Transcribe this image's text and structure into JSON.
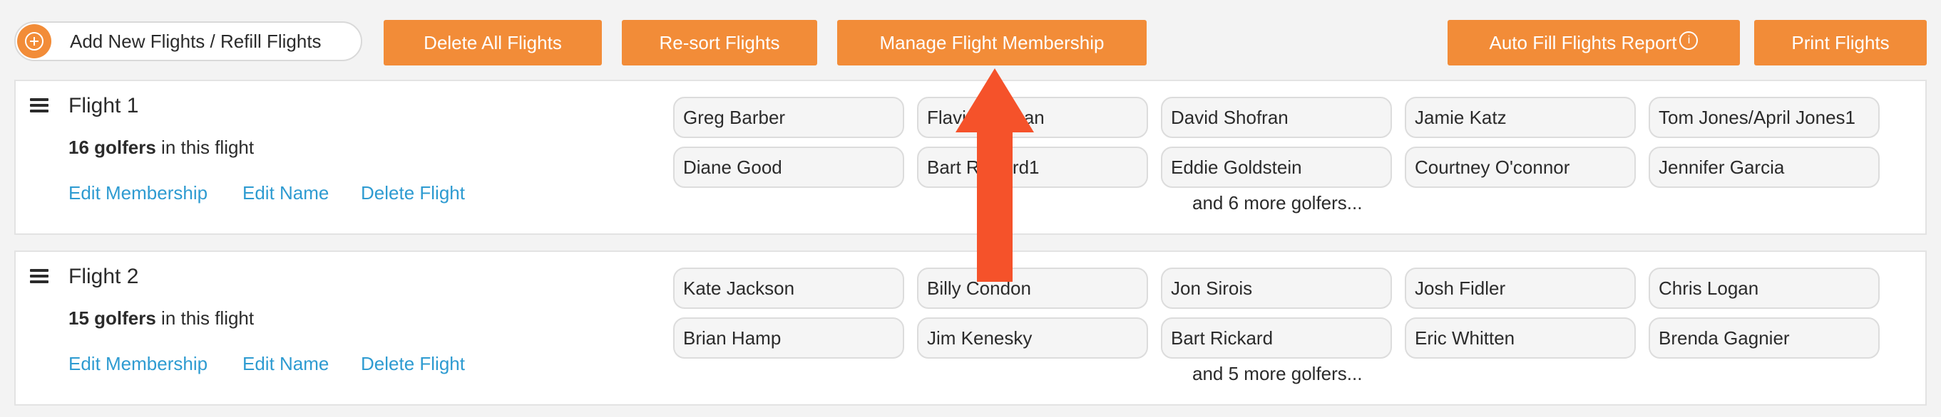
{
  "toolbar": {
    "add_label": "Add New Flights / Refill Flights",
    "delete_all_label": "Delete All Flights",
    "resort_label": "Re-sort Flights",
    "manage_label": "Manage Flight Membership",
    "autofill_label": "Auto Fill Flights Report",
    "print_label": "Print Flights"
  },
  "flights": [
    {
      "title": "Flight 1",
      "count": "16 golfers",
      "count_suffix": " in this flight",
      "links": {
        "edit_membership": "Edit Membership",
        "edit_name": "Edit Name",
        "delete": "Delete Flight"
      },
      "golfers": [
        "Greg Barber",
        "Flavio Hassan",
        "David Shofran",
        "Jamie Katz",
        "Tom Jones/April Jones1",
        "Diane Good",
        "Bart Rickard1",
        "Eddie Goldstein",
        "Courtney O'connor",
        "Jennifer Garcia"
      ],
      "more": "and 6 more golfers..."
    },
    {
      "title": "Flight 2",
      "count": "15 golfers",
      "count_suffix": " in this flight",
      "links": {
        "edit_membership": "Edit Membership",
        "edit_name": "Edit Name",
        "delete": "Delete Flight"
      },
      "golfers": [
        "Kate Jackson",
        "Billy Condon",
        "Jon Sirois",
        "Josh Fidler",
        "Chris Logan",
        "Brian Hamp",
        "Jim Kenesky",
        "Bart Rickard",
        "Eric Whitten",
        "Brenda Gagnier"
      ],
      "more": "and 5 more golfers..."
    }
  ],
  "colors": {
    "accent": "#f28c38",
    "link": "#2e9bd1",
    "arrow": "#f5522a"
  },
  "icons": {
    "add": "plus-circle-icon",
    "info": "info-icon",
    "drag": "hamburger-icon",
    "annotation": "arrow-up-icon"
  }
}
